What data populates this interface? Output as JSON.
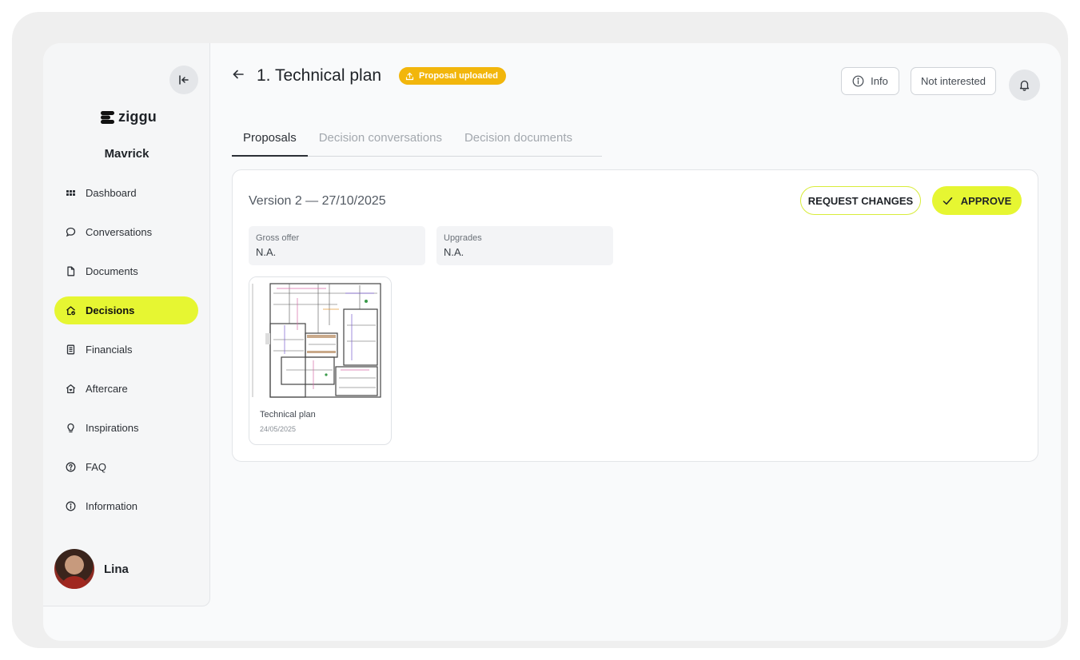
{
  "sidebar": {
    "logo_text": "ziggu",
    "org_name": "Mavrick",
    "items": [
      {
        "label": "Dashboard",
        "icon": "grid-icon"
      },
      {
        "label": "Conversations",
        "icon": "chat-bubble-icon"
      },
      {
        "label": "Documents",
        "icon": "document-icon"
      },
      {
        "label": "Decisions",
        "icon": "home-check-icon",
        "active": true
      },
      {
        "label": "Financials",
        "icon": "receipt-icon"
      },
      {
        "label": "Aftercare",
        "icon": "house-heart-icon"
      },
      {
        "label": "Inspirations",
        "icon": "lightbulb-icon"
      },
      {
        "label": "FAQ",
        "icon": "question-circle-icon"
      },
      {
        "label": "Information",
        "icon": "info-circle-icon"
      }
    ],
    "user_name": "Lina"
  },
  "header": {
    "title": "1. Technical plan",
    "badge": "Proposal uploaded",
    "info_label": "Info",
    "not_interested_label": "Not interested"
  },
  "tabs": [
    {
      "label": "Proposals",
      "active": true
    },
    {
      "label": "Decision conversations",
      "active": false
    },
    {
      "label": "Decision documents",
      "active": false
    }
  ],
  "proposal": {
    "version": "Version 2 — 27/10/2025",
    "request_changes_label": "REQUEST CHANGES",
    "approve_label": "APPROVE",
    "fields": [
      {
        "label": "Gross offer",
        "value": "N.A."
      },
      {
        "label": "Upgrades",
        "value": "N.A."
      }
    ],
    "document": {
      "title": "Technical plan",
      "date": "24/05/2025"
    }
  },
  "colors": {
    "accent": "#e6f632",
    "badge": "#f2b60c"
  }
}
